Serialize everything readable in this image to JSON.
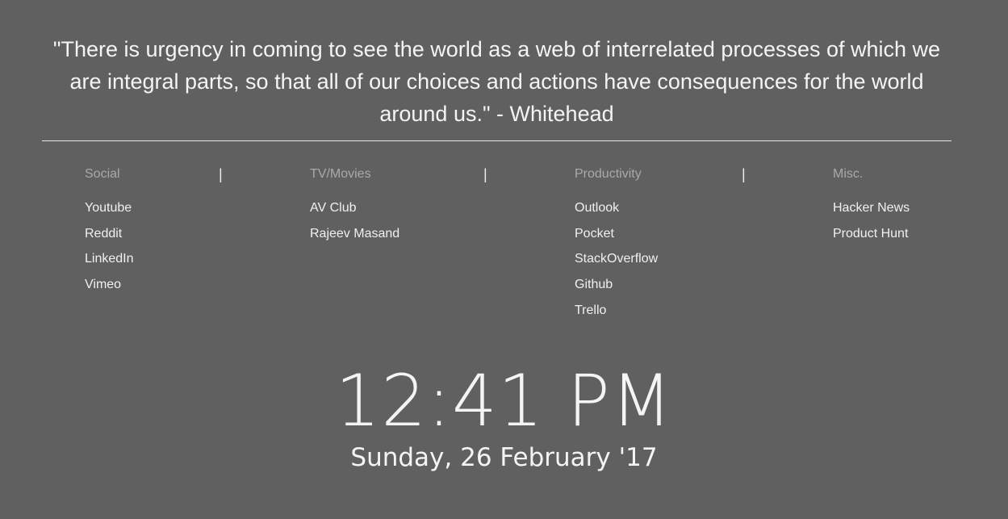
{
  "quote": {
    "text": "\"There is urgency in coming to see the world as a web of interrelated processes of which we are integral parts, so that all of our choices and actions have consequences for the world around us.\" - Whitehead"
  },
  "separator_glyph": "|",
  "columns": [
    {
      "heading": "Social",
      "links": [
        "Youtube",
        "Reddit",
        "LinkedIn",
        "Vimeo"
      ]
    },
    {
      "heading": "TV/Movies",
      "links": [
        "AV Club",
        "Rajeev Masand"
      ]
    },
    {
      "heading": "Productivity",
      "links": [
        "Outlook",
        "Pocket",
        "StackOverflow",
        "Github",
        "Trello"
      ]
    },
    {
      "heading": "Misc.",
      "links": [
        "Hacker News",
        "Product Hunt"
      ]
    }
  ],
  "clock": {
    "time": "12:41 PM",
    "date": "Sunday, 26 February '17"
  },
  "colors": {
    "background": "#606060",
    "text": "#f2f2f2",
    "heading": "#a9a9a9"
  }
}
